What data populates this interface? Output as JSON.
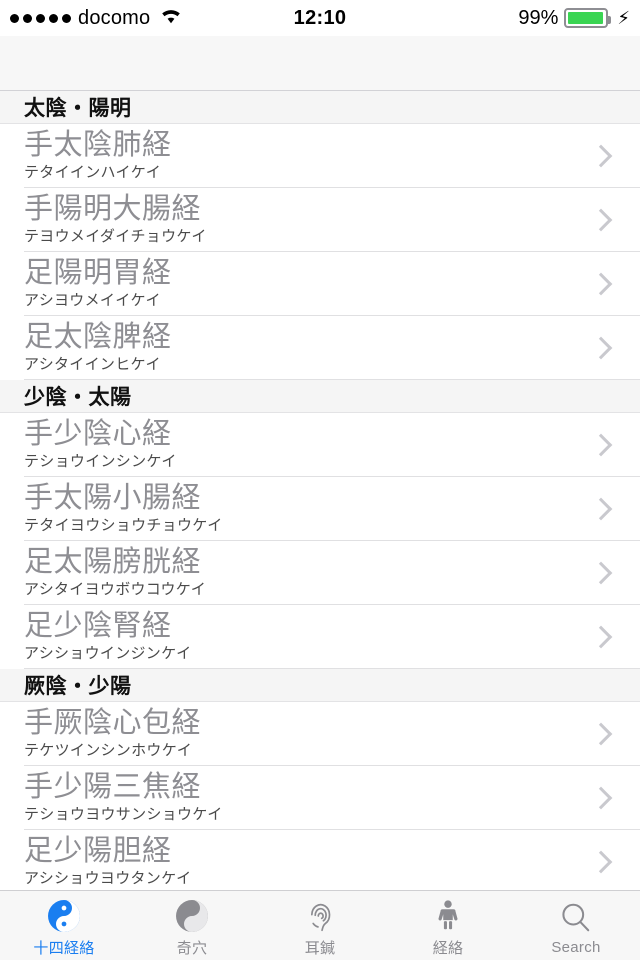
{
  "status_bar": {
    "signal_dots": 5,
    "carrier": "docomo",
    "wifi_icon": "wifi-icon",
    "time": "12:10",
    "battery_percent": "99%",
    "battery_level": 95,
    "charging_icon": "lightning-bolt-icon",
    "battery_color": "#3ad553"
  },
  "navbar": {
    "title": ""
  },
  "list": {
    "sections": [
      {
        "header": "太陰・陽明",
        "rows": [
          {
            "title": "手太陰肺経",
            "subtitle": "テタイインハイケイ"
          },
          {
            "title": "手陽明大腸経",
            "subtitle": "テヨウメイダイチョウケイ"
          },
          {
            "title": "足陽明胃経",
            "subtitle": "アシヨウメイイケイ"
          },
          {
            "title": "足太陰脾経",
            "subtitle": "アシタイインヒケイ"
          }
        ]
      },
      {
        "header": "少陰・太陽",
        "rows": [
          {
            "title": "手少陰心経",
            "subtitle": "テショウインシンケイ"
          },
          {
            "title": "手太陽小腸経",
            "subtitle": "テタイヨウショウチョウケイ"
          },
          {
            "title": "足太陽膀胱経",
            "subtitle": "アシタイヨウボウコウケイ"
          },
          {
            "title": "足少陰腎経",
            "subtitle": "アシショウインジンケイ"
          }
        ]
      },
      {
        "header": "厥陰・少陽",
        "rows": [
          {
            "title": "手厥陰心包経",
            "subtitle": "テケツインシンホウケイ"
          },
          {
            "title": "手少陽三焦経",
            "subtitle": "テショウヨウサンショウケイ"
          },
          {
            "title": "足少陽胆経",
            "subtitle": "アシショウヨウタンケイ"
          }
        ]
      }
    ],
    "disclosure_icon": "chevron-right-icon",
    "title_color": "#8e8e93",
    "subtitle_color": "#4a4a4a",
    "header_bg": "#f5f5f5"
  },
  "tabbar": {
    "active_color": "#1a7ef0",
    "inactive_color": "#8b8b90",
    "tabs": [
      {
        "label": "十四経絡",
        "icon": "yin-yang-icon",
        "active": true
      },
      {
        "label": "奇穴",
        "icon": "yin-yang-icon",
        "active": false
      },
      {
        "label": "耳鍼",
        "icon": "ear-icon",
        "active": false
      },
      {
        "label": "経絡",
        "icon": "person-body-icon",
        "active": false
      },
      {
        "label": "Search",
        "icon": "magnifier-icon",
        "active": false
      }
    ]
  }
}
